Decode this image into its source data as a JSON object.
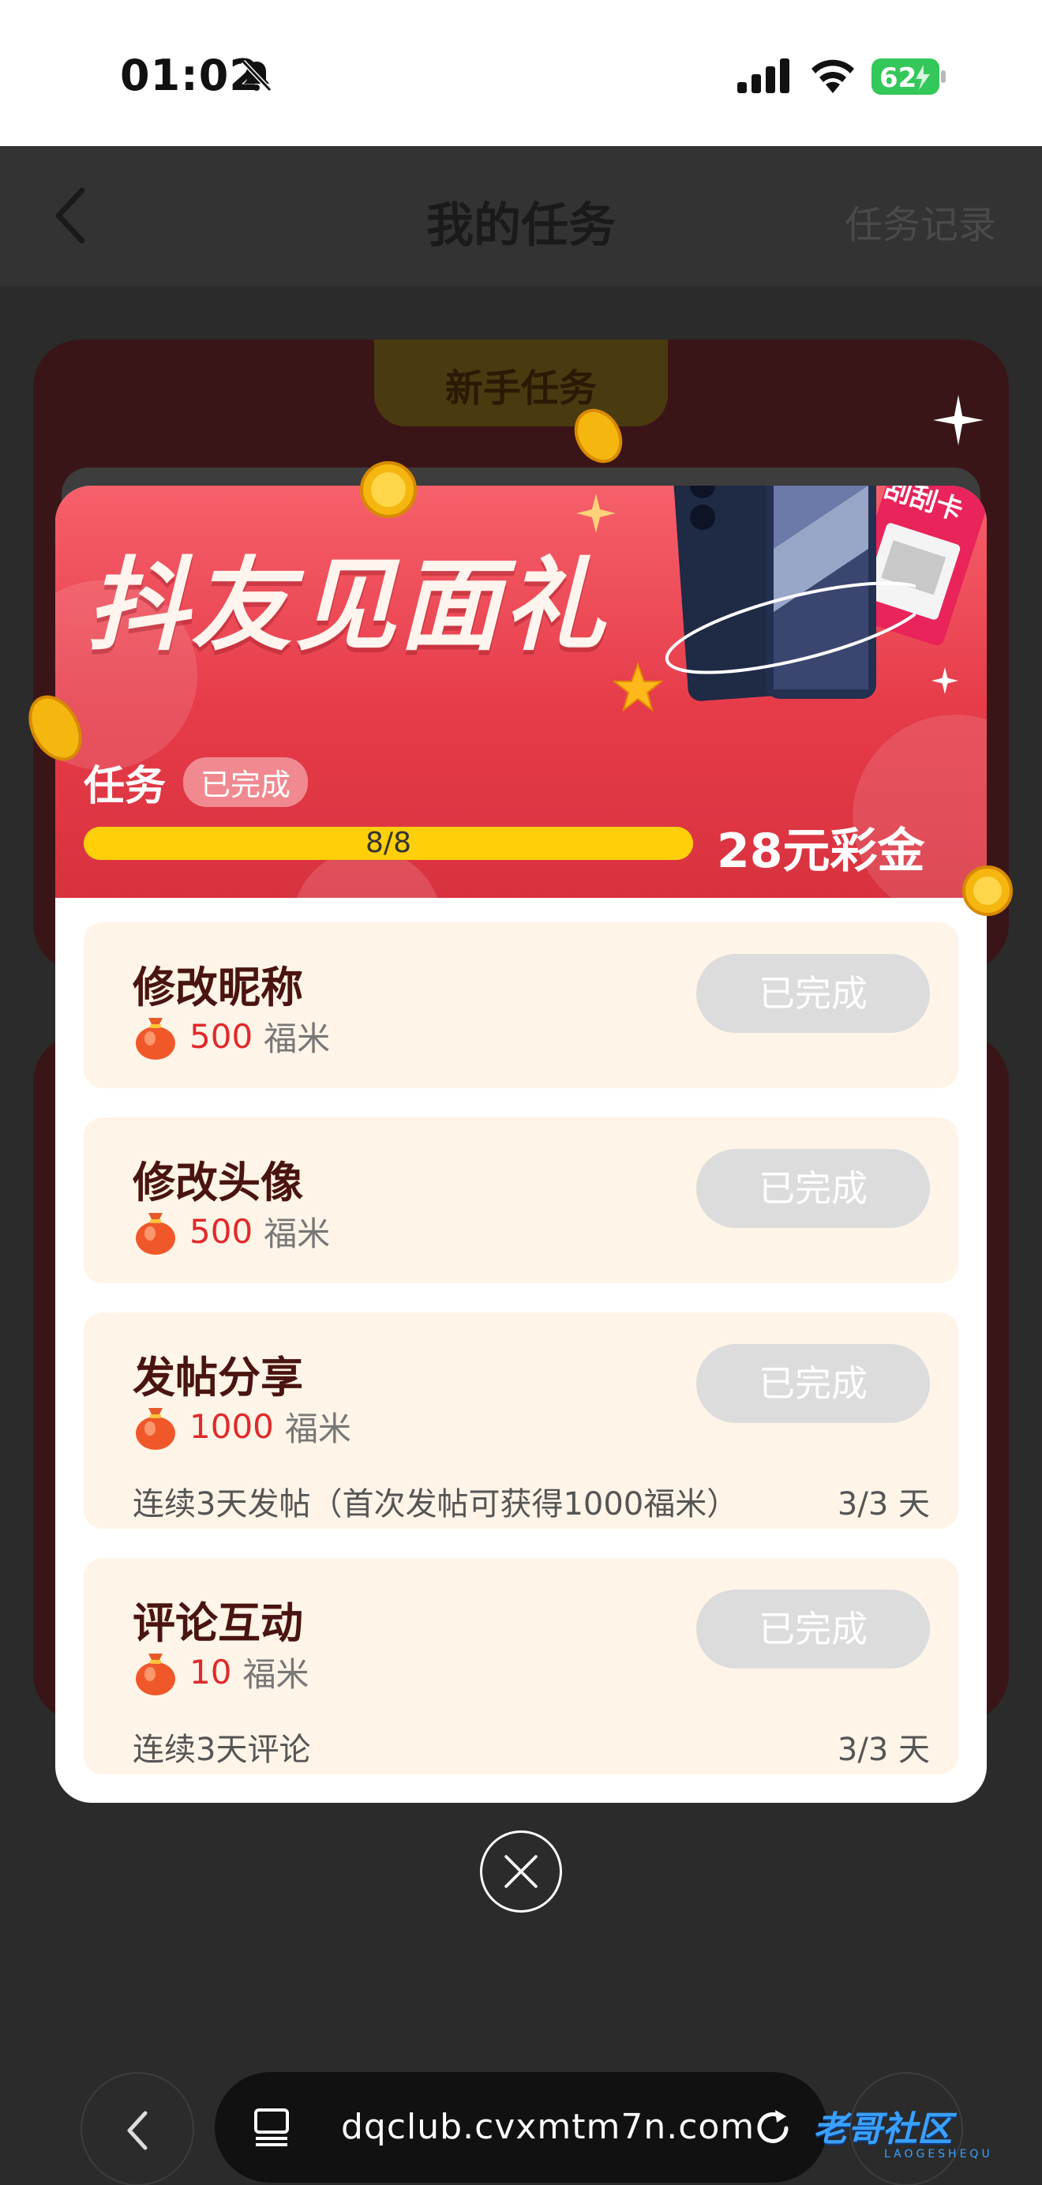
{
  "status_bar": {
    "time": "01:02",
    "battery": "62"
  },
  "nav": {
    "title": "我的任务",
    "record_label": "任务记录"
  },
  "background": {
    "tab_label": "新手任务"
  },
  "banner": {
    "title": "抖友见面礼",
    "task_label": "任务",
    "status_badge": "已完成",
    "progress_text": "8/8",
    "progress_fraction": 1.0,
    "reward": "28元彩金",
    "scratch_card_text": "刮刮卡"
  },
  "tasks": [
    {
      "name": "修改昵称",
      "reward_amount": "500",
      "reward_unit": "福米",
      "button": "已完成",
      "desc": "",
      "days": ""
    },
    {
      "name": "修改头像",
      "reward_amount": "500",
      "reward_unit": "福米",
      "button": "已完成",
      "desc": "",
      "days": ""
    },
    {
      "name": "发帖分享",
      "reward_amount": "1000",
      "reward_unit": "福米",
      "button": "已完成",
      "desc": "连续3天发帖（首次发帖可获得1000福米）",
      "days": "3/3 天"
    },
    {
      "name": "评论互动",
      "reward_amount": "10",
      "reward_unit": "福米",
      "button": "已完成",
      "desc": "连续3天评论",
      "days": "3/3 天"
    }
  ],
  "browser": {
    "url": "dqclub.cvxmtm7n.com"
  },
  "watermark": {
    "text": "老哥社区",
    "sub": "LAOGESHEQU"
  }
}
